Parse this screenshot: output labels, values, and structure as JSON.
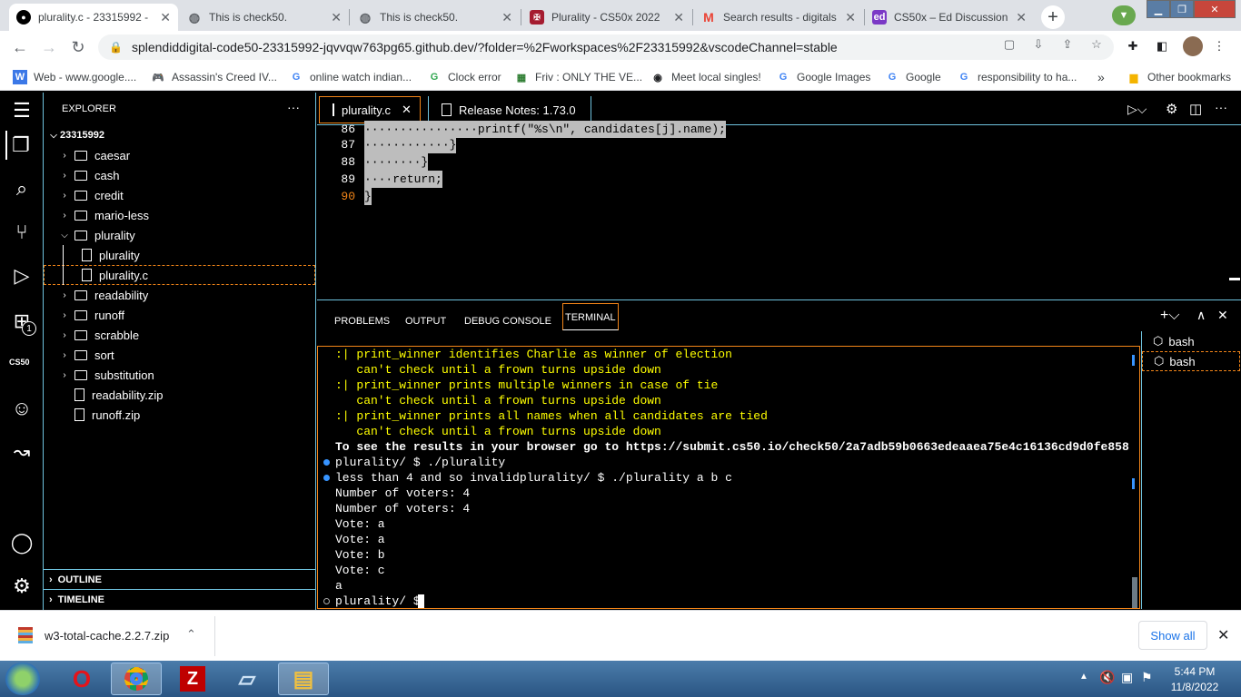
{
  "browser": {
    "tabs": [
      {
        "title": "plurality.c - 23315992 -",
        "active": true,
        "icon": "github-icon"
      },
      {
        "title": "This is check50.",
        "icon": "globe-icon"
      },
      {
        "title": "This is check50.",
        "icon": "globe-icon"
      },
      {
        "title": "Plurality - CS50x 2022",
        "icon": "harvard-shield-icon"
      },
      {
        "title": "Search results - digitals",
        "icon": "gmail-icon"
      },
      {
        "title": "CS50x – Ed Discussion",
        "icon": "ed-icon",
        "icon_text": "ed"
      }
    ],
    "url": "splendiddigital-code50-23315992-jqvvqw763pg65.github.dev/?folder=%2Fworkspaces%2F23315992&vscodeChannel=stable",
    "bookmarks": [
      {
        "label": "Web - www.google....",
        "icon_text": "W"
      },
      {
        "label": "Assassin's Creed IV...",
        "icon_text": "🎮"
      },
      {
        "label": "online watch indian...",
        "icon_text": "G"
      },
      {
        "label": "Clock error",
        "icon_text": "G"
      },
      {
        "label": "Friv : ONLY THE VE...",
        "icon_text": "▦"
      },
      {
        "label": "Meet local singles!",
        "icon_text": "◉"
      },
      {
        "label": "Google Images",
        "icon_text": "G"
      },
      {
        "label": "Google",
        "icon_text": "G"
      },
      {
        "label": "responsibility to ha...",
        "icon_text": "G"
      }
    ],
    "bookmarks_more": "»",
    "other_bookmarks": "Other bookmarks"
  },
  "vscode": {
    "explorer_title": "EXPLORER",
    "workspace": "23315992",
    "tree": [
      {
        "label": "caesar",
        "type": "folder",
        "expanded": false
      },
      {
        "label": "cash",
        "type": "folder",
        "expanded": false
      },
      {
        "label": "credit",
        "type": "folder",
        "expanded": false
      },
      {
        "label": "mario-less",
        "type": "folder",
        "expanded": false
      },
      {
        "label": "plurality",
        "type": "folder",
        "expanded": true
      },
      {
        "label": "plurality",
        "type": "file",
        "indent": 1
      },
      {
        "label": "plurality.c",
        "type": "file",
        "indent": 1,
        "selected": true
      },
      {
        "label": "readability",
        "type": "folder",
        "expanded": false
      },
      {
        "label": "runoff",
        "type": "folder",
        "expanded": false
      },
      {
        "label": "scrabble",
        "type": "folder",
        "expanded": false
      },
      {
        "label": "sort",
        "type": "folder",
        "expanded": false
      },
      {
        "label": "substitution",
        "type": "folder",
        "expanded": false
      },
      {
        "label": "readability.zip",
        "type": "file"
      },
      {
        "label": "runoff.zip",
        "type": "file"
      }
    ],
    "outline": "OUTLINE",
    "timeline": "TIMELINE",
    "cs50_label": "CS50",
    "badge_count": "1",
    "editor_tabs": [
      {
        "label": "plurality.c",
        "active": true
      },
      {
        "label": "Release Notes: 1.73.0"
      }
    ],
    "code_lines": [
      {
        "num": "86",
        "text": "················printf(\"%s\\n\", candidates[j].name);"
      },
      {
        "num": "87",
        "text": "············}"
      },
      {
        "num": "88",
        "text": "········}"
      },
      {
        "num": "89",
        "text": "····return;"
      },
      {
        "num": "90",
        "text": "}"
      }
    ],
    "panel_tabs": [
      "PROBLEMS",
      "OUTPUT",
      "DEBUG CONSOLE",
      "TERMINAL"
    ],
    "terminals": [
      "bash",
      "bash"
    ],
    "terminal_lines": [
      {
        "text": ":| print_winner identifies Charlie as winner of election",
        "color": "yel"
      },
      {
        "text": "   can't check until a frown turns upside down",
        "color": "yel"
      },
      {
        "text": ":| print_winner prints multiple winners in case of tie",
        "color": "yel"
      },
      {
        "text": "   can't check until a frown turns upside down",
        "color": "yel"
      },
      {
        "text": ":| print_winner prints all names when all candidates are tied",
        "color": "yel"
      },
      {
        "text": "   can't check until a frown turns upside down",
        "color": "yel"
      },
      {
        "text": "To see the results in your browser go to https://submit.cs50.io/check50/2a7adb59b0663edeaaea75e4c16136cd9d0fe858",
        "color": "wht bold"
      },
      {
        "text": "plurality/ $ ./plurality",
        "color": "wht",
        "dot": "#3794ff"
      },
      {
        "text": "less than 4 and so invalidplurality/ $ ./plurality a b c",
        "color": "wht",
        "dot": "#3794ff"
      },
      {
        "text": "Number of voters: 4",
        "color": "wht"
      },
      {
        "text": "Number of voters: 4",
        "color": "wht"
      },
      {
        "text": "Vote: a",
        "color": "wht"
      },
      {
        "text": "Vote: a",
        "color": "wht"
      },
      {
        "text": "Vote: b",
        "color": "wht"
      },
      {
        "text": "Vote: c",
        "color": "wht"
      },
      {
        "text": "a",
        "color": "wht"
      },
      {
        "text": "plurality/ $ ",
        "color": "wht",
        "dot": "hollow"
      }
    ]
  },
  "download": {
    "file": "w3-total-cache.2.2.7.zip",
    "show_all": "Show all"
  },
  "taskbar": {
    "time": "5:44 PM",
    "date": "11/8/2022",
    "apps": [
      "opera-icon",
      "chrome-icon",
      "filezilla-icon",
      "notepad-icon",
      "explorer-icon"
    ]
  }
}
